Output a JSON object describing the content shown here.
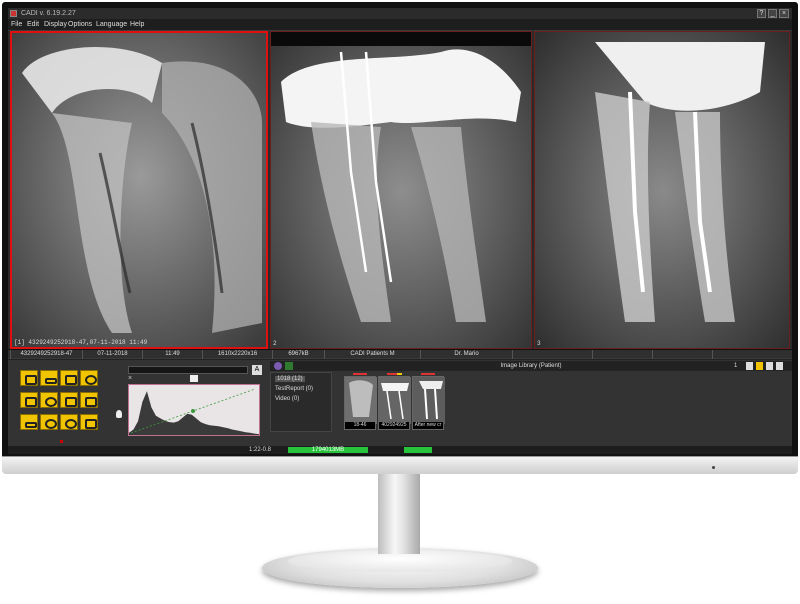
{
  "window": {
    "title": "CADI v. 6.19.2.27",
    "controls": {
      "help": "?",
      "minimize": "_",
      "maximize": "□",
      "close": "×"
    }
  },
  "menu": [
    "File",
    "Edit",
    "Display",
    "Options",
    "Language",
    "Help"
  ],
  "viewports": [
    {
      "label": "[1] 4329249252918-47,07-11-2018 11:49",
      "active": true
    },
    {
      "label": "2",
      "active": false
    },
    {
      "label": "3",
      "active": false
    }
  ],
  "infobar": {
    "patient_id": "4329249252918-47",
    "date": "07-11-2018",
    "time": "11:49",
    "dimensions": "1610x2220x16",
    "file_size": "6967kB",
    "patient": "CADI Patients M",
    "doctor": "Dr. Mario"
  },
  "histogram": {
    "channel_label": "A",
    "x_label": "×",
    "bins": [
      0.05,
      0.12,
      0.3,
      0.72,
      0.95,
      0.6,
      0.42,
      0.36,
      0.31,
      0.28,
      0.27,
      0.3,
      0.38,
      0.46,
      0.44,
      0.36,
      0.28,
      0.24,
      0.21,
      0.2,
      0.19,
      0.17,
      0.15,
      0.12,
      0.1,
      0.08,
      0.06,
      0.05,
      0.03,
      0.02
    ]
  },
  "library": {
    "title": "Image Library (Patient)",
    "page": "1",
    "tree": [
      "1018 (12)",
      "TestReport (0)",
      "Video (0)"
    ],
    "thumbnails": [
      "18-46",
      "402924925",
      "After new cr"
    ]
  },
  "status": {
    "left_value": "1:22-0.8",
    "memory": "1794013MB"
  },
  "colors": {
    "active_border": "#e01010",
    "tool_yellow": "#f0c400",
    "status_green": "#27c33b"
  }
}
